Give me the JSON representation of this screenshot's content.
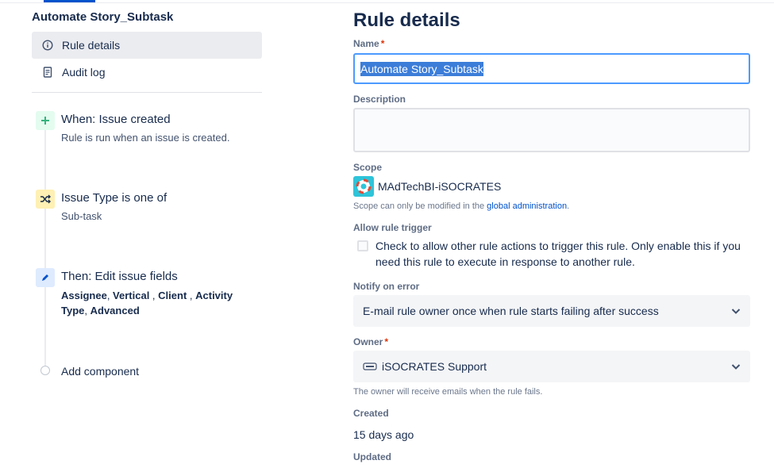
{
  "sidebar": {
    "rule_name": "Automate Story_Subtask",
    "nav": [
      {
        "label": "Rule details",
        "icon": "info-icon"
      },
      {
        "label": "Audit log",
        "icon": "document-icon"
      }
    ],
    "components": [
      {
        "title": "When: Issue created",
        "subtitle": "Rule is run when an issue is created.",
        "icon": "plus-icon",
        "color": "#36b37e"
      },
      {
        "title": "Issue Type is one of",
        "subtitle": "Sub-task",
        "icon": "shuffle-icon",
        "color": "#ff991f"
      },
      {
        "title": "Then: Edit issue fields",
        "icon": "pencil-icon",
        "color": "#0052cc",
        "fields": [
          "Assignee",
          "Vertical",
          "Client",
          "Activity Type",
          "Advanced"
        ]
      }
    ],
    "add_component": "Add component"
  },
  "details": {
    "title": "Rule details",
    "name_label": "Name",
    "name_value": "Automate Story_Subtask",
    "description_label": "Description",
    "description_value": "",
    "scope_label": "Scope",
    "scope_value": "MAdTechBI-iSOCRATES",
    "scope_hint_prefix": "Scope can only be modified in the ",
    "scope_hint_link": "global administration",
    "scope_hint_suffix": ".",
    "trigger_label": "Allow rule trigger",
    "trigger_text": "Check to allow other rule actions to trigger this rule. Only enable this if you need this rule to execute in response to another rule.",
    "trigger_checked": false,
    "notify_label": "Notify on error",
    "notify_value": "E-mail rule owner once when rule starts failing after success",
    "owner_label": "Owner",
    "owner_value": "iSOCRATES Support",
    "owner_hint": "The owner will receive emails when the rule fails.",
    "created_label": "Created",
    "created_value": "15 days ago",
    "updated_label": "Updated"
  },
  "colors": {
    "accent": "#0052cc",
    "focus": "#4c9aff",
    "required": "#de350b",
    "selection": "#3c7dd9"
  }
}
